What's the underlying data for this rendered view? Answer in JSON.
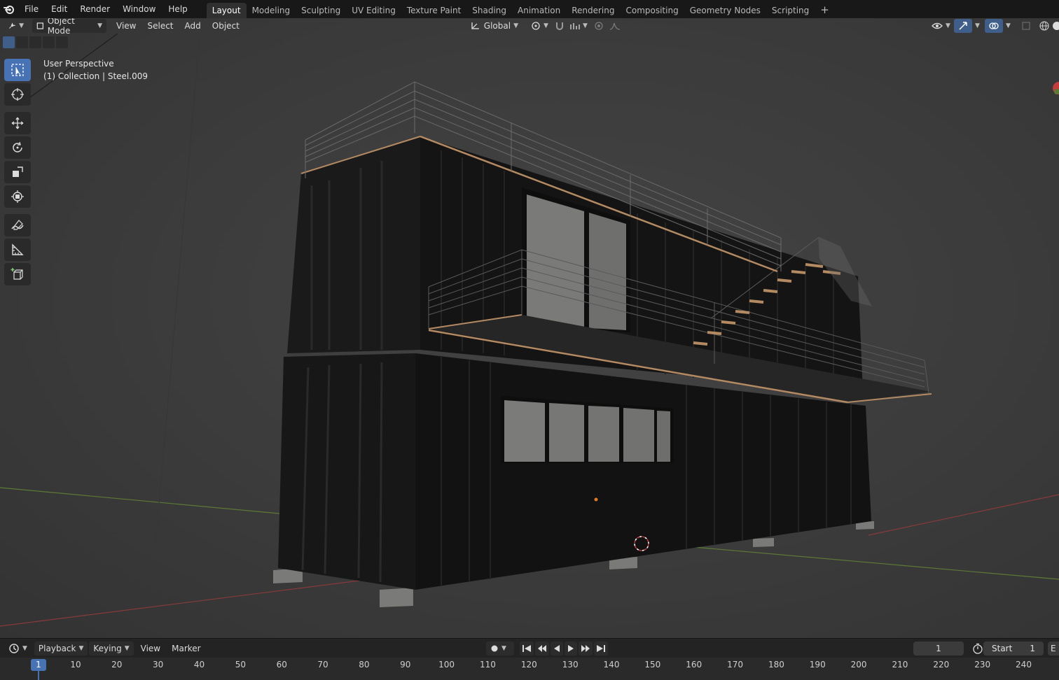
{
  "topbar": {
    "menu": [
      "File",
      "Edit",
      "Render",
      "Window",
      "Help"
    ],
    "workspaces": [
      "Layout",
      "Modeling",
      "Sculpting",
      "UV Editing",
      "Texture Paint",
      "Shading",
      "Animation",
      "Rendering",
      "Compositing",
      "Geometry Nodes",
      "Scripting"
    ],
    "active_workspace": "Layout",
    "add_tab": "+"
  },
  "viewport_header": {
    "editor_type_icon": "3d-viewport-icon",
    "mode": "Object Mode",
    "menus": [
      "View",
      "Select",
      "Add",
      "Object"
    ],
    "orientation": "Global"
  },
  "viewport": {
    "perspective_label": "User Perspective",
    "collection_label": "(1) Collection | Steel.009"
  },
  "toolbar": {
    "tools": [
      "select-box-icon",
      "cursor-icon",
      "move-icon",
      "rotate-icon",
      "scale-icon",
      "transform-icon",
      "annotate-icon",
      "measure-icon",
      "add-cube-icon"
    ],
    "active": "select-box-icon"
  },
  "timeline": {
    "menus": [
      "Playback",
      "Keying",
      "View",
      "Marker"
    ],
    "current_frame": "1",
    "start_label": "Start",
    "start_value": "1",
    "end_label": "E",
    "ruler_ticks": [
      "10",
      "20",
      "30",
      "40",
      "50",
      "60",
      "70",
      "80",
      "90",
      "100",
      "110",
      "120",
      "130",
      "140",
      "150",
      "160",
      "170",
      "180",
      "190",
      "200",
      "210",
      "220",
      "230",
      "240"
    ],
    "marker_label": "1"
  },
  "colors": {
    "accent": "#4772b3",
    "x_axis": "#8a3a3a",
    "y_axis": "#5d7a34",
    "cursor_ring": "#c43c3c",
    "origin_dot": "#e07a1f"
  }
}
